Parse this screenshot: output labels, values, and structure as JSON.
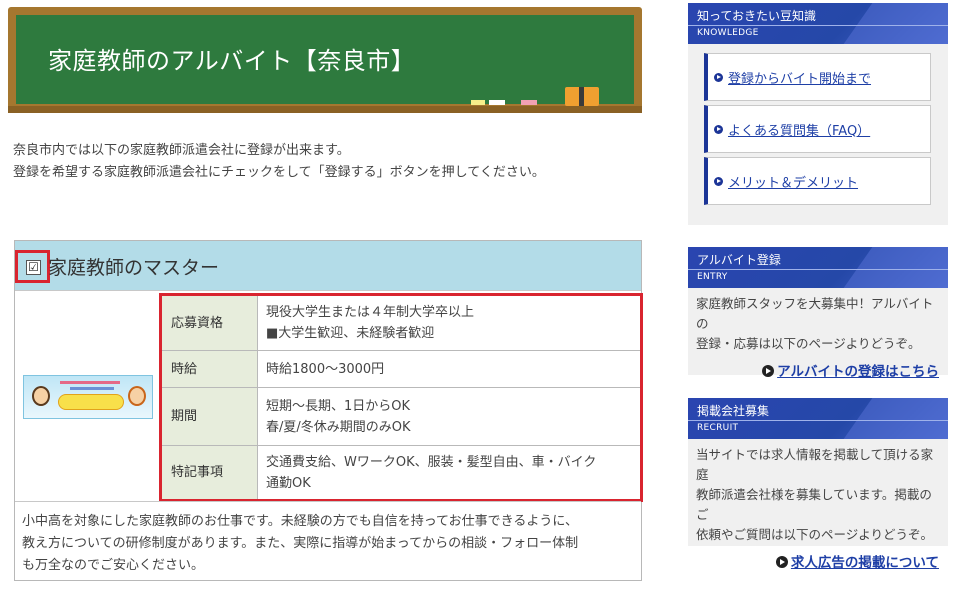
{
  "header": {
    "title": "家庭教師のアルバイト【奈良市】"
  },
  "intro": {
    "line1": "奈良市内では以下の家庭教師派遣会社に登録が出来ます。",
    "line2": "登録を希望する家庭教師派遣会社にチェックをして「登録する」ボタンを押してください。"
  },
  "company": {
    "name": "家庭教師のマスター",
    "checked": true,
    "check_mark": "☑",
    "rows": [
      {
        "key": "応募資格",
        "value_line1": "現役大学生または４年制大学卒以上",
        "value_line2": "■大学生歓迎、未経験者歓迎"
      },
      {
        "key": "時給",
        "value_line1": "時給1800～3000円",
        "value_line2": ""
      },
      {
        "key": "期間",
        "value_line1": "短期～長期、1日からOK",
        "value_line2": "春/夏/冬休み期間のみOK"
      },
      {
        "key": "特記事項",
        "value_line1": "交通費支給、WワークOK、服装・髪型自由、車・バイク",
        "value_line2": "通勤OK"
      }
    ],
    "description_line1": "小中高を対象にした家庭教師のお仕事です。未経験の方でも自信を持ってお仕事できるように、",
    "description_line2": "教え方についての研修制度があります。また、実際に指導が始まってからの相談・フォロー体制",
    "description_line3": "も万全なのでご安心ください。"
  },
  "sidebar": {
    "knowledge": {
      "title": "知っておきたい豆知識",
      "subtitle": "KNOWLEDGE",
      "links": [
        "登録からバイト開始まで",
        "よくある質問集（FAQ）",
        "メリット＆デメリット"
      ]
    },
    "entry": {
      "title": "アルバイト登録",
      "subtitle": "ENTRY",
      "text_line1": "家庭教師スタッフを大募集中！アルバイトの",
      "text_line2": "登録・応募は以下のページよりどうぞ。",
      "link": "アルバイトの登録はこちら"
    },
    "recruit": {
      "title": "掲載会社募集",
      "subtitle": "RECRUIT",
      "text_line1": "当サイトでは求人情報を掲載して頂ける家庭",
      "text_line2": "教師派遣会社様を募集しています。掲載のご",
      "text_line3": "依頼やご質問は以下のページよりどうぞ。",
      "link": "求人広告の掲載について"
    }
  },
  "colors": {
    "board_green": "#2e7a3e",
    "board_frame": "#a5772f",
    "card_header": "#b3dce8",
    "highlight_red": "#d9242f",
    "sidebar_blue": "#2a45b0",
    "link_blue": "#1e3fa6"
  }
}
